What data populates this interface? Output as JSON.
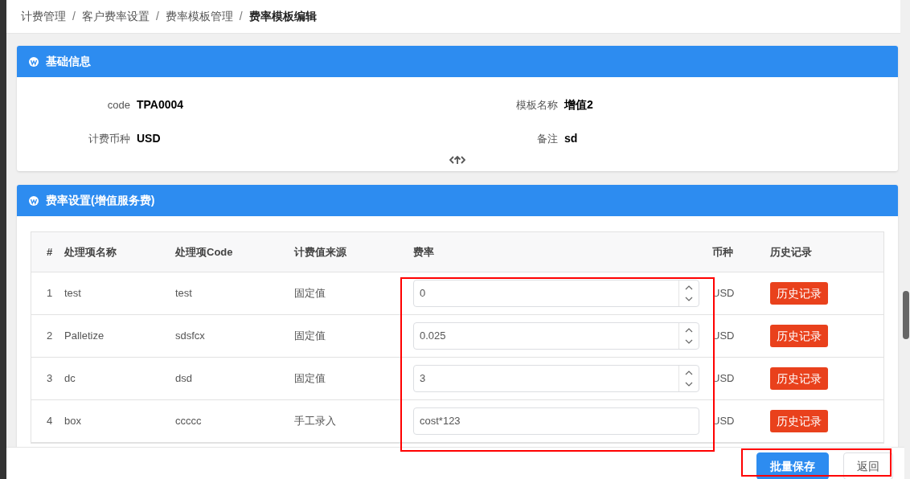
{
  "breadcrumb": [
    {
      "label": "计费管理",
      "current": false
    },
    {
      "label": "客户费率设置",
      "current": false
    },
    {
      "label": "费率模板管理",
      "current": false
    },
    {
      "label": "费率模板编辑",
      "current": true
    }
  ],
  "separator": "/",
  "basic_panel": {
    "title": "基础信息",
    "fields": [
      {
        "label": "code",
        "value": "TPA0004"
      },
      {
        "label": "模板名称",
        "value": "增值2"
      },
      {
        "label": "计费币种",
        "value": "USD"
      },
      {
        "label": "备注",
        "value": "sd"
      }
    ]
  },
  "rate_panel": {
    "title": "费率设置(增值服务费)",
    "columns": [
      "#",
      "处理项名称",
      "处理项Code",
      "计费值来源",
      "费率",
      "币种",
      "历史记录"
    ],
    "rows": [
      {
        "index": "1",
        "name": "test",
        "code": "test",
        "source": "固定值",
        "rate": "0",
        "kind": "number",
        "currency": "USD",
        "history": "历史记录"
      },
      {
        "index": "2",
        "name": "Palletize",
        "code": "sdsfcx",
        "source": "固定值",
        "rate": "0.025",
        "kind": "number",
        "currency": "USD",
        "history": "历史记录"
      },
      {
        "index": "3",
        "name": "dc",
        "code": "dsd",
        "source": "固定值",
        "rate": "3",
        "kind": "number",
        "currency": "USD",
        "history": "历史记录"
      },
      {
        "index": "4",
        "name": "box",
        "code": "ccccc",
        "source": "手工录入",
        "rate": "cost*123",
        "kind": "text",
        "currency": "USD",
        "history": "历史记录"
      }
    ]
  },
  "footer": {
    "buttons": [
      {
        "label": "批量保存",
        "kind": "primary"
      },
      {
        "label": "返回",
        "kind": "default"
      }
    ]
  }
}
